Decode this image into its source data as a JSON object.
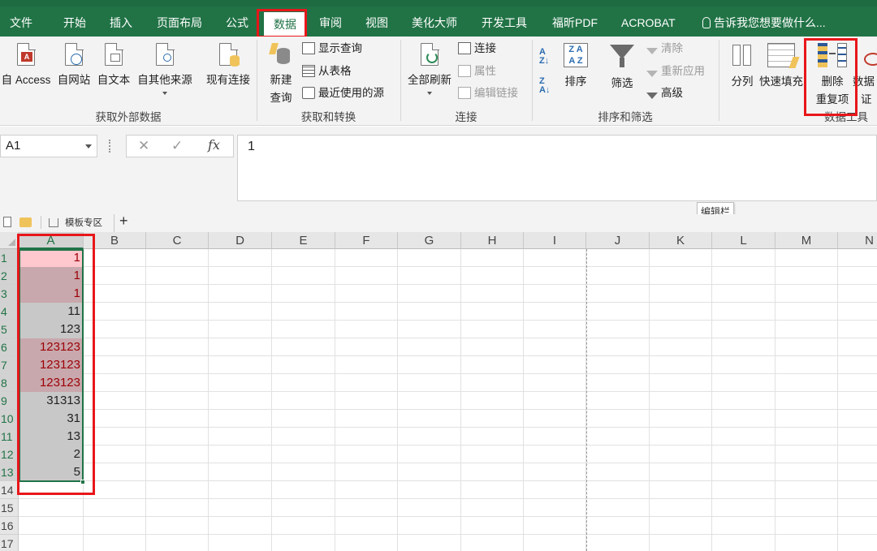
{
  "tabs": [
    "文件",
    "开始",
    "插入",
    "页面布局",
    "公式",
    "数据",
    "审阅",
    "视图",
    "美化大师",
    "开发工具",
    "福昕PDF",
    "ACROBAT"
  ],
  "active_tab": "数据",
  "tell_me": "告诉我您想要做什么...",
  "ribbon": {
    "external": {
      "access": "自 Access",
      "web": "自网站",
      "text": "自文本",
      "other": "自其他来源",
      "existing": "现有连接",
      "group": "获取外部数据"
    },
    "transform": {
      "new_query_1": "新建",
      "new_query_2": "查询",
      "show_queries": "显示查询",
      "from_table": "从表格",
      "recent_sources": "最近使用的源",
      "group": "获取和转换"
    },
    "connections": {
      "refresh_all": "全部刷新",
      "connections": "连接",
      "properties": "属性",
      "edit_links": "编辑链接",
      "group": "连接"
    },
    "sort_filter": {
      "sort": "排序",
      "filter": "筛选",
      "clear": "清除",
      "reapply": "重新应用",
      "advanced": "高级",
      "group": "排序和筛选"
    },
    "data_tools": {
      "text_to_columns": "分列",
      "flash_fill": "快速填充",
      "remove_dup_1": "删除",
      "remove_dup_2": "重复项",
      "validation_1": "数据",
      "validation_2": "证",
      "group": "数据工具"
    }
  },
  "formula_bar": {
    "name_box": "A1",
    "formula": "1",
    "tooltip": "编辑栏",
    "fx": "fx",
    "cancel": "✕",
    "enter": "✓"
  },
  "sheet_tabs": {
    "template_zone": "模板专区",
    "add": "+"
  },
  "columns": [
    "A",
    "B",
    "C",
    "D",
    "E",
    "F",
    "G",
    "H",
    "I",
    "J",
    "K",
    "L",
    "M",
    "N"
  ],
  "rows": [
    "1",
    "2",
    "3",
    "4",
    "5",
    "6",
    "7",
    "8",
    "9",
    "10",
    "11",
    "12",
    "13",
    "14",
    "15",
    "16",
    "17"
  ],
  "column_a_values": [
    "1",
    "1",
    "1",
    "11",
    "123",
    "123123",
    "123123",
    "123123",
    "31313",
    "31",
    "13",
    "2",
    "5"
  ],
  "duplicate_rows": [
    1,
    2,
    3,
    6,
    7,
    8
  ],
  "colors": {
    "excel_green": "#217346",
    "highlight_red": "#e8161a",
    "duplicate_fill": "#ffc7ce",
    "duplicate_text": "#9c0006"
  }
}
